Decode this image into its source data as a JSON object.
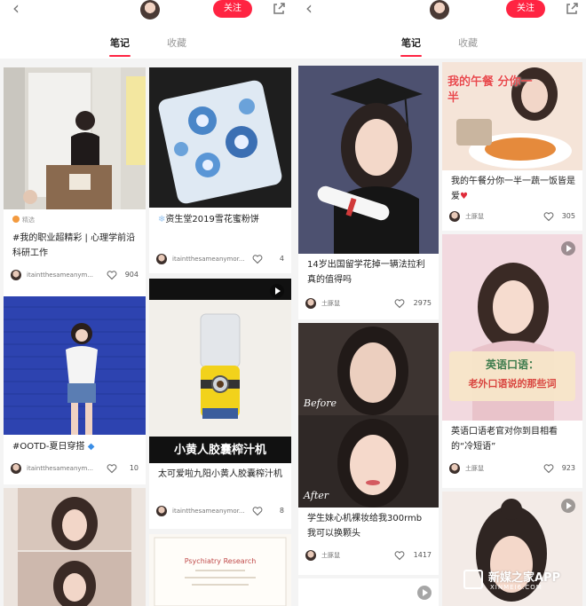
{
  "colors": {
    "accent": "#ff2442",
    "feed_bg": "#f4f4f4",
    "tag_orange": "#f39a3f"
  },
  "left": {
    "header": {
      "back_icon": "chevron-left-icon",
      "follow_label": "关注",
      "share_icon": "share-icon"
    },
    "tabs": {
      "notes": "笔记",
      "favorites": "收藏"
    },
    "cards": [
      {
        "tag": "精选",
        "title": "#我的职业超精彩 | 心理学前沿科研工作",
        "user": "itaintthesameanym...",
        "likes": "904"
      },
      {
        "title": "资生堂2019雪花蜜粉饼",
        "user": "itaintthesameanymor...",
        "likes": "4"
      },
      {
        "title": "#OOTD-夏日穿搭",
        "user": "itaintthesameanym...",
        "likes": "10"
      },
      {
        "overlay": "小黄人胶囊榨汁机",
        "title": "太可爱啦九阳小黄人胶囊榨汁机",
        "user": "itaintthesameanymor...",
        "likes": "8"
      },
      {
        "overlay": "Psychiatry Research"
      }
    ]
  },
  "right": {
    "header": {
      "back_icon": "chevron-left-icon",
      "follow_label": "关注",
      "share_icon": "share-icon"
    },
    "tabs": {
      "notes": "笔记",
      "favorites": "收藏"
    },
    "cards": [
      {
        "overlay": "我的午餐 分你一半",
        "title": "我的午餐分你一半一蔬一饭皆是爱",
        "user": "土豚鼠",
        "likes": "305"
      },
      {
        "title": "14岁出国留学花掉一辆法拉利 真的值得吗",
        "user": "土豚鼠",
        "likes": "2975"
      },
      {
        "overlay_top": "英语口语：",
        "overlay_bottom": "老外口语说的那些词",
        "title": "英语口语老官对你到目相看的“冷短语”",
        "user": "土豚鼠",
        "likes": "923"
      },
      {
        "label_before": "Before",
        "label_after": "After",
        "title": "学生妹心机裸妆给我300rmb 我可以换颗头",
        "user": "土豚鼠",
        "likes": "1417"
      }
    ]
  },
  "watermark": {
    "name": "新媒之家APP",
    "site": "XINMEI6.COM"
  }
}
